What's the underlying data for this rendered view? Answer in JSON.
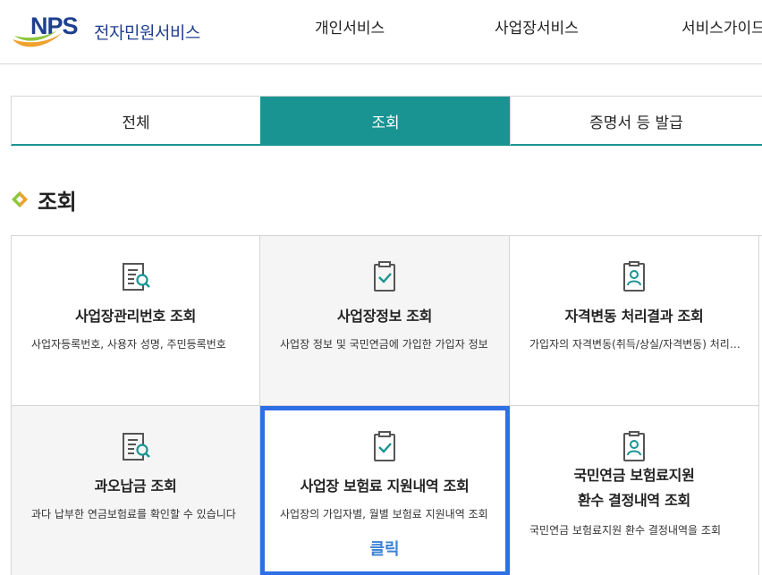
{
  "header": {
    "logo_mark": "NPS",
    "logo_text": "전자민원서비스",
    "nav": [
      "개인서비스",
      "사업장서비스",
      "서비스가이드"
    ]
  },
  "tabs": [
    {
      "label": "전체",
      "active": false
    },
    {
      "label": "조회",
      "active": true
    },
    {
      "label": "증명서 등 발급",
      "active": false
    }
  ],
  "section": {
    "title": "조회"
  },
  "cards": [
    {
      "title": "사업장관리번호 조회",
      "desc": "사업자등록번호, 사용자 성명, 주민등록번호",
      "icon": "document-search-icon"
    },
    {
      "title": "사업장정보 조회",
      "desc": "사업장 정보 및 국민연금에 가입한 가입자 정보",
      "icon": "clipboard-check-icon"
    },
    {
      "title": "자격변동 처리결과 조회",
      "desc": "가입자의 자격변동(취득/상실/자격변동) 처리결과",
      "icon": "person-badge-icon"
    },
    {
      "title": "과오납금 조회",
      "desc": "과다 납부한 연금보험료를 확인할 수 있습니다",
      "icon": "document-search-icon"
    },
    {
      "title": "사업장 보험료 지원내역 조회",
      "desc": "사업장의 가입자별, 월별 보험료 지원내역 조회",
      "icon": "clipboard-check-icon",
      "click_hint": "클릭"
    },
    {
      "title_line1": "국민연금 보험료지원",
      "title_line2": "환수 결정내역 조회",
      "desc": "국민연금 보험료지원 환수 결정내역을 조회",
      "icon": "person-badge-icon"
    }
  ],
  "colors": {
    "accent": "#1a9493",
    "brand": "#1f3f8f",
    "highlight": "#2f6fe5"
  }
}
